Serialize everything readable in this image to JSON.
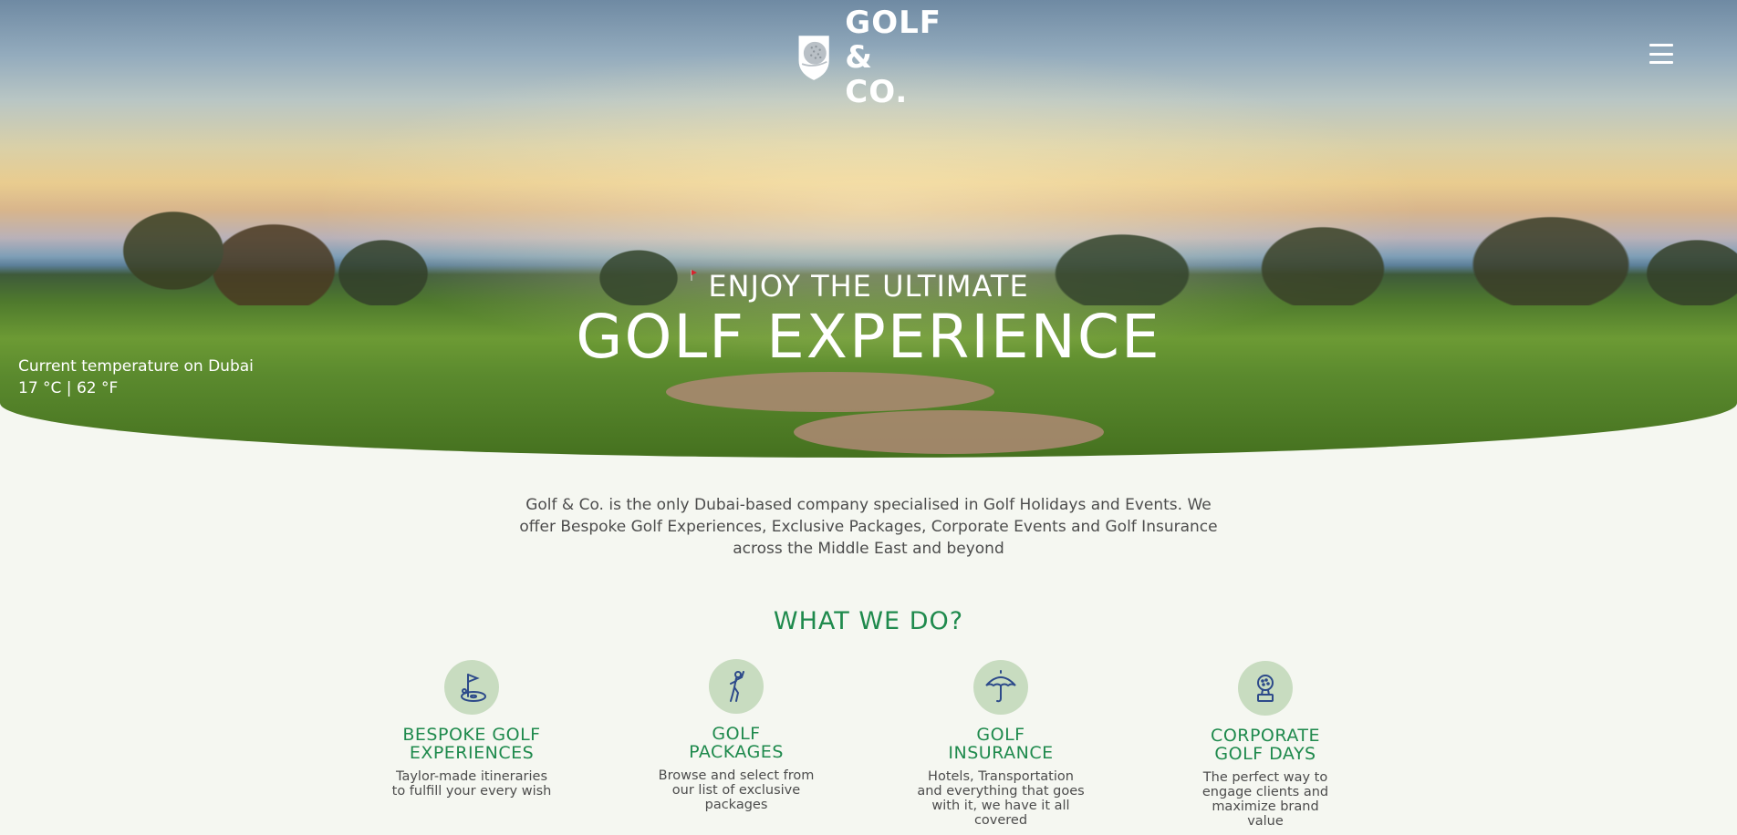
{
  "brand": {
    "name_line1": "GOLF",
    "name_line2": "& CO."
  },
  "menu": {
    "icon": "hamburger-menu-icon"
  },
  "hero": {
    "subtitle": "ENJOY THE ULTIMATE",
    "title": "GOLF EXPERIENCE"
  },
  "weather": {
    "label": "Current temperature on Dubai",
    "value": "17 °C | 62 °F"
  },
  "intro": {
    "text": "Golf & Co. is the only Dubai-based company specialised in Golf Holidays and Events. We offer Bespoke Golf Experiences, Exclusive Packages, Corporate Events and Golf Insurance across the Middle East and beyond"
  },
  "services_section": {
    "title": "WHAT WE DO?",
    "items": [
      {
        "icon": "golf-flag-icon",
        "title_line1": "BESPOKE GOLF",
        "title_line2": "EXPERIENCES",
        "desc": "Taylor-made itineraries to fulfill your every wish"
      },
      {
        "icon": "golfer-icon",
        "title_line1": "GOLF",
        "title_line2": "PACKAGES",
        "desc": "Browse and select from our list of exclusive packages"
      },
      {
        "icon": "umbrella-icon",
        "title_line1": "GOLF",
        "title_line2": "INSURANCE",
        "desc": "Hotels, Transportation and everything that goes with it, we have it all covered"
      },
      {
        "icon": "trophy-icon",
        "title_line1": "CORPORATE",
        "title_line2": "GOLF DAYS",
        "desc": "The perfect way to engage clients and maximize brand value"
      }
    ]
  },
  "colors": {
    "accent": "#1f8a4d",
    "icon_bg": "#c8dcc0",
    "icon_stroke": "#2d4a8a",
    "page_bg": "#f5f7f1"
  }
}
